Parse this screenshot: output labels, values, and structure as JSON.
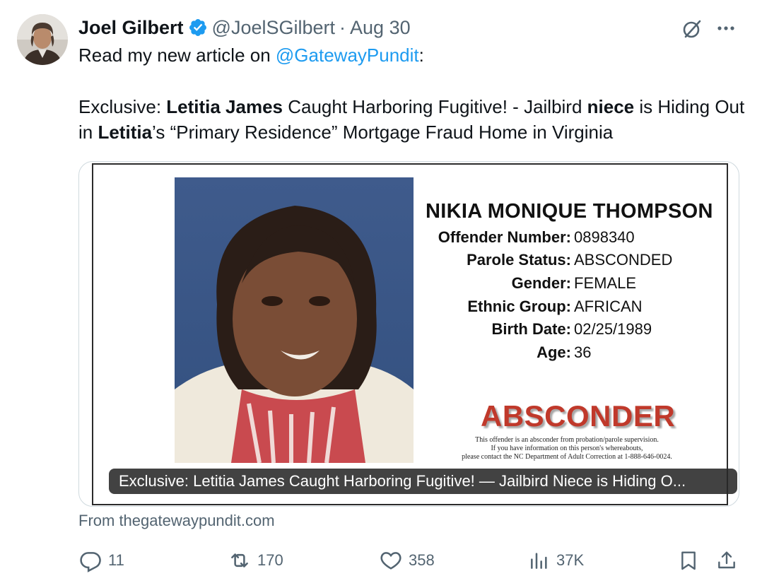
{
  "author": {
    "name": "Joel Gilbert",
    "handle": "@JoelSGilbert",
    "separator": "·",
    "date": "Aug 30"
  },
  "tweet": {
    "intro_before": "Read my new article on ",
    "intro_mention": "@GatewayPundit",
    "intro_after": ":",
    "headline_parts": [
      "Exclusive: ",
      "Letitia James",
      " Caught Harboring Fugitive! - Jailbird ",
      "niece",
      " is Hiding Out in ",
      "Letitia",
      "’s “Primary Residence” Mortgage Fraud Home in Virginia"
    ]
  },
  "card": {
    "offender_name": "NIKIA MONIQUE THOMPSON",
    "fields": [
      {
        "label": "Offender Number:",
        "value": "0898340"
      },
      {
        "label": "Parole Status:",
        "value": "ABSCONDED"
      },
      {
        "label": "Gender:",
        "value": "FEMALE"
      },
      {
        "label": "Ethnic Group:",
        "value": "AFRICAN"
      },
      {
        "label": "Birth Date:",
        "value": "02/25/1989"
      },
      {
        "label": "Age:",
        "value": "36"
      }
    ],
    "stamp": "ABSCONDER",
    "notice_lines": [
      "This offender is an absconder from probation/parole supervision.",
      "If you have information on this person's whereabouts,",
      "please contact the NC Department of Adult Correction at 1-888-646-0024."
    ],
    "caption": "Exclusive: Letitia James Caught Harboring Fugitive! — Jailbird Niece is Hiding O...",
    "source": "From thegatewaypundit.com"
  },
  "actions": {
    "replies": "11",
    "reposts": "170",
    "likes": "358",
    "views": "37K"
  },
  "colors": {
    "accent": "#1d9bf0",
    "secondary_text": "#536471",
    "stamp_red": "#c0392b"
  },
  "icons": [
    "verified-badge-icon",
    "grok-icon",
    "more-icon",
    "reply-icon",
    "retweet-icon",
    "like-icon",
    "views-icon",
    "bookmark-icon",
    "share-icon"
  ]
}
